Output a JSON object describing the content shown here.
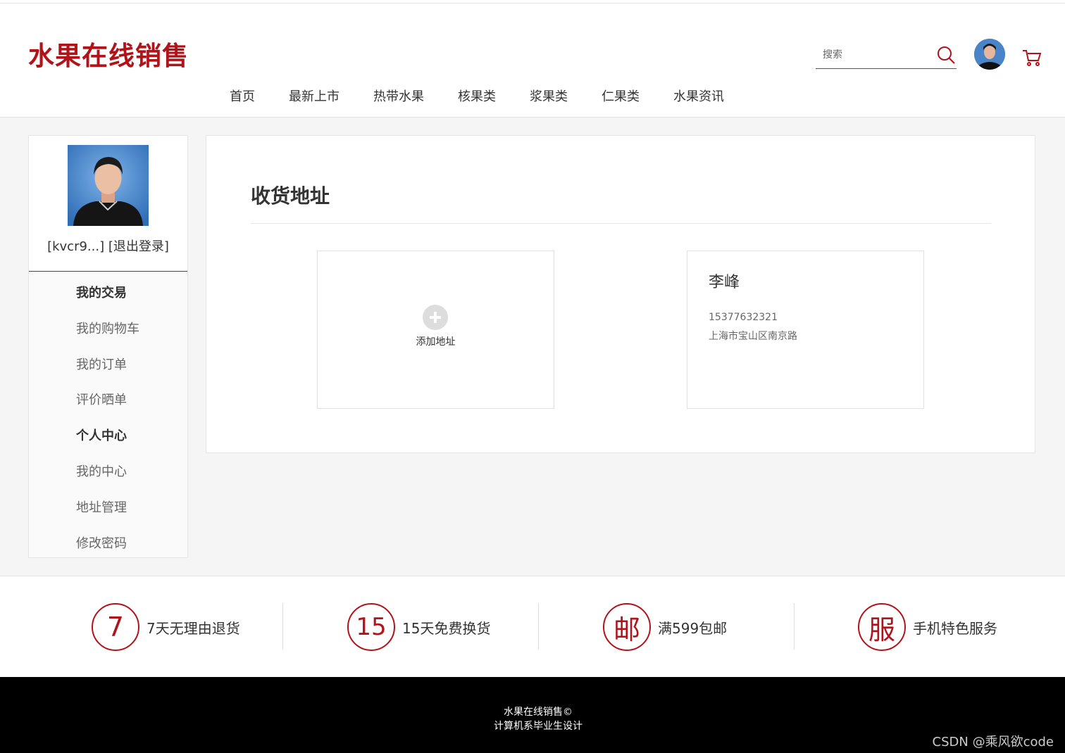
{
  "header": {
    "logo": "水果在线销售",
    "nav": [
      "首页",
      "最新上市",
      "热带水果",
      "核果类",
      "浆果类",
      "仁果类",
      "水果资讯"
    ],
    "search_placeholder": "搜索"
  },
  "sidebar": {
    "username": "[kvcr9...]",
    "logout": "[退出登录]",
    "menu": [
      {
        "label": "我的交易",
        "type": "head"
      },
      {
        "label": "我的购物车",
        "type": "item"
      },
      {
        "label": "我的订单",
        "type": "item"
      },
      {
        "label": "评价晒单",
        "type": "item"
      },
      {
        "label": "个人中心",
        "type": "head"
      },
      {
        "label": "我的中心",
        "type": "item"
      },
      {
        "label": "地址管理",
        "type": "item"
      },
      {
        "label": "修改密码",
        "type": "item"
      }
    ]
  },
  "main": {
    "title": "收货地址",
    "add_label": "添加地址",
    "address": {
      "name": "李峰",
      "phone": "15377632321",
      "location": "上海市宝山区南京路"
    }
  },
  "services": [
    {
      "icon_text": "7",
      "label": "7天无理由退货"
    },
    {
      "icon_text": "15",
      "label": "15天免费换货"
    },
    {
      "icon_text": "邮",
      "label": "满599包邮"
    },
    {
      "icon_text": "服",
      "label": "手机特色服务"
    }
  ],
  "footer": {
    "line1": "水果在线销售©",
    "line2": "计算机系毕业生设计",
    "watermark": "CSDN @乘风欲code"
  },
  "colors": {
    "brand": "#b0131a",
    "background": "#f5f5f5",
    "footer": "#000000"
  }
}
